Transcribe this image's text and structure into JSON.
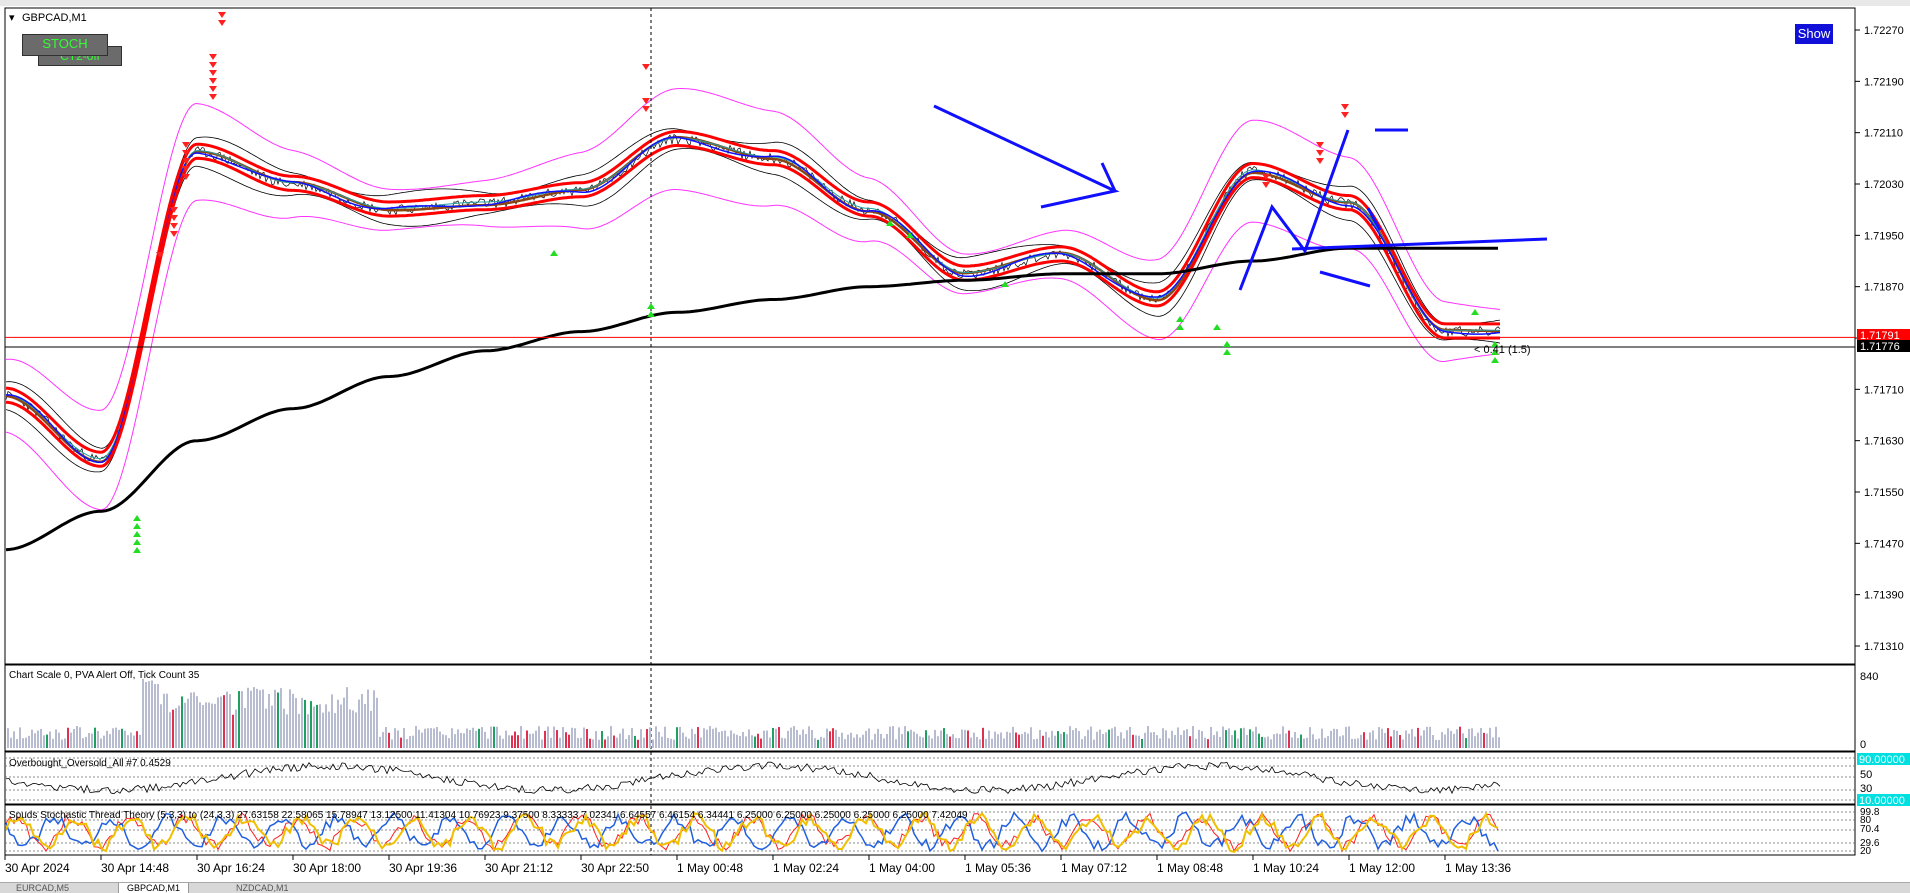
{
  "main_pane": {
    "symbol_label": "GBPCAD,M1",
    "show_button": "Show",
    "stoch_button": "STOCH",
    "ct2_button": "CT2-off",
    "price_ticks": [
      "1.72270",
      "1.72190",
      "1.72110",
      "1.72030",
      "1.71950",
      "1.71870",
      "1.71790",
      "1.71710",
      "1.71630",
      "1.71550",
      "1.71470",
      "1.71390",
      "1.71310"
    ],
    "price_tag_red": "1.71791",
    "price_tag_black": "1.71776",
    "measure_text": "< 0.41 (1.5)"
  },
  "volume_pane": {
    "label": "Chart Scale  0,   PVA Alert Off,   Tick Count  35",
    "scale_top": "840",
    "scale_bottom": "0"
  },
  "obos_pane": {
    "label": "Overbought_Oversold_All #7 0.4529",
    "level_hi": "90.00000",
    "level_50": "50",
    "level_30": "30",
    "level_lo": "10.00000"
  },
  "stoch_pane": {
    "label": "Spuds Stochastic Thread Theory (5,3,3) to (24,3,3) 27.63158 22.58065 15.78947 13.12500 11.41304 10.76923 9.37500 8.33333 7.02341 6.64557 6.46154 6.34441 6.25000 6.25000 6.25000 6.25000 6.25000 7.42049",
    "level_top": "99.8",
    "level_hi": "80",
    "level_mid": "70.4",
    "level_lo": "29.6",
    "level_bottom": "20"
  },
  "time_axis": [
    "30 Apr 2024",
    "30 Apr 14:48",
    "30 Apr 16:24",
    "30 Apr 18:00",
    "30 Apr 19:36",
    "30 Apr 21:12",
    "30 Apr 22:50",
    "1 May 00:48",
    "1 May 02:24",
    "1 May 04:00",
    "1 May 05:36",
    "1 May 07:12",
    "1 May 08:48",
    "1 May 10:24",
    "1 May 12:00",
    "1 May 13:36"
  ],
  "tabs": [
    "EURCAD,M5",
    "GBPCAD,M1",
    "NZDCAD,M1"
  ],
  "colors": {
    "bull_arrow": "#22dd22",
    "bear_arrow": "#ff2020",
    "red_band": "#ff0000",
    "blue_ma": "#1010ff",
    "brown_ma": "#8b4513",
    "bollinger": "#ff33ff",
    "ma200": "#000000",
    "stoch_yellow": "#f0c000",
    "stoch_blue": "#2060e0"
  },
  "chart_data": [
    {
      "type": "line",
      "title": "GBPCAD,M1",
      "x": [
        "30 Apr 2024",
        "30 Apr 14:48",
        "30 Apr 16:24",
        "30 Apr 18:00",
        "30 Apr 19:36",
        "30 Apr 21:12",
        "30 Apr 22:50",
        "1 May 00:48",
        "1 May 02:24",
        "1 May 04:00",
        "1 May 05:36",
        "1 May 07:12",
        "1 May 08:48",
        "1 May 10:24",
        "1 May 12:00",
        "1 May 13:36"
      ],
      "ylim": [
        1.7127,
        1.7231
      ],
      "series": [
        {
          "values": [
            1.717,
            1.716,
            1.7208,
            1.7203,
            1.7199,
            1.72,
            1.7202,
            1.721,
            1.7207,
            1.7199,
            1.7189,
            1.7192,
            1.7185,
            1.7205,
            1.72,
            1.718
          ]
        },
        {
          "values": [
            1.7146,
            1.7152,
            1.7163,
            1.7168,
            1.7173,
            1.7177,
            1.718,
            1.7183,
            1.7185,
            1.7187,
            1.7188,
            1.7189,
            1.7189,
            1.7191,
            1.7193,
            1.7193
          ]
        }
      ]
    },
    {
      "type": "bar",
      "title": "Chart Scale  0,   PVA Alert Off,   Tick Count  35",
      "ylim": [
        0,
        840
      ]
    },
    {
      "type": "line",
      "title": "Overbought_Oversold_All #7 0.4529",
      "ylim": [
        0,
        100
      ]
    },
    {
      "type": "line",
      "title": "Spuds Stochastic Thread Theory (5,3,3) to (24,3,3)",
      "ylim": [
        0,
        100
      ]
    }
  ]
}
